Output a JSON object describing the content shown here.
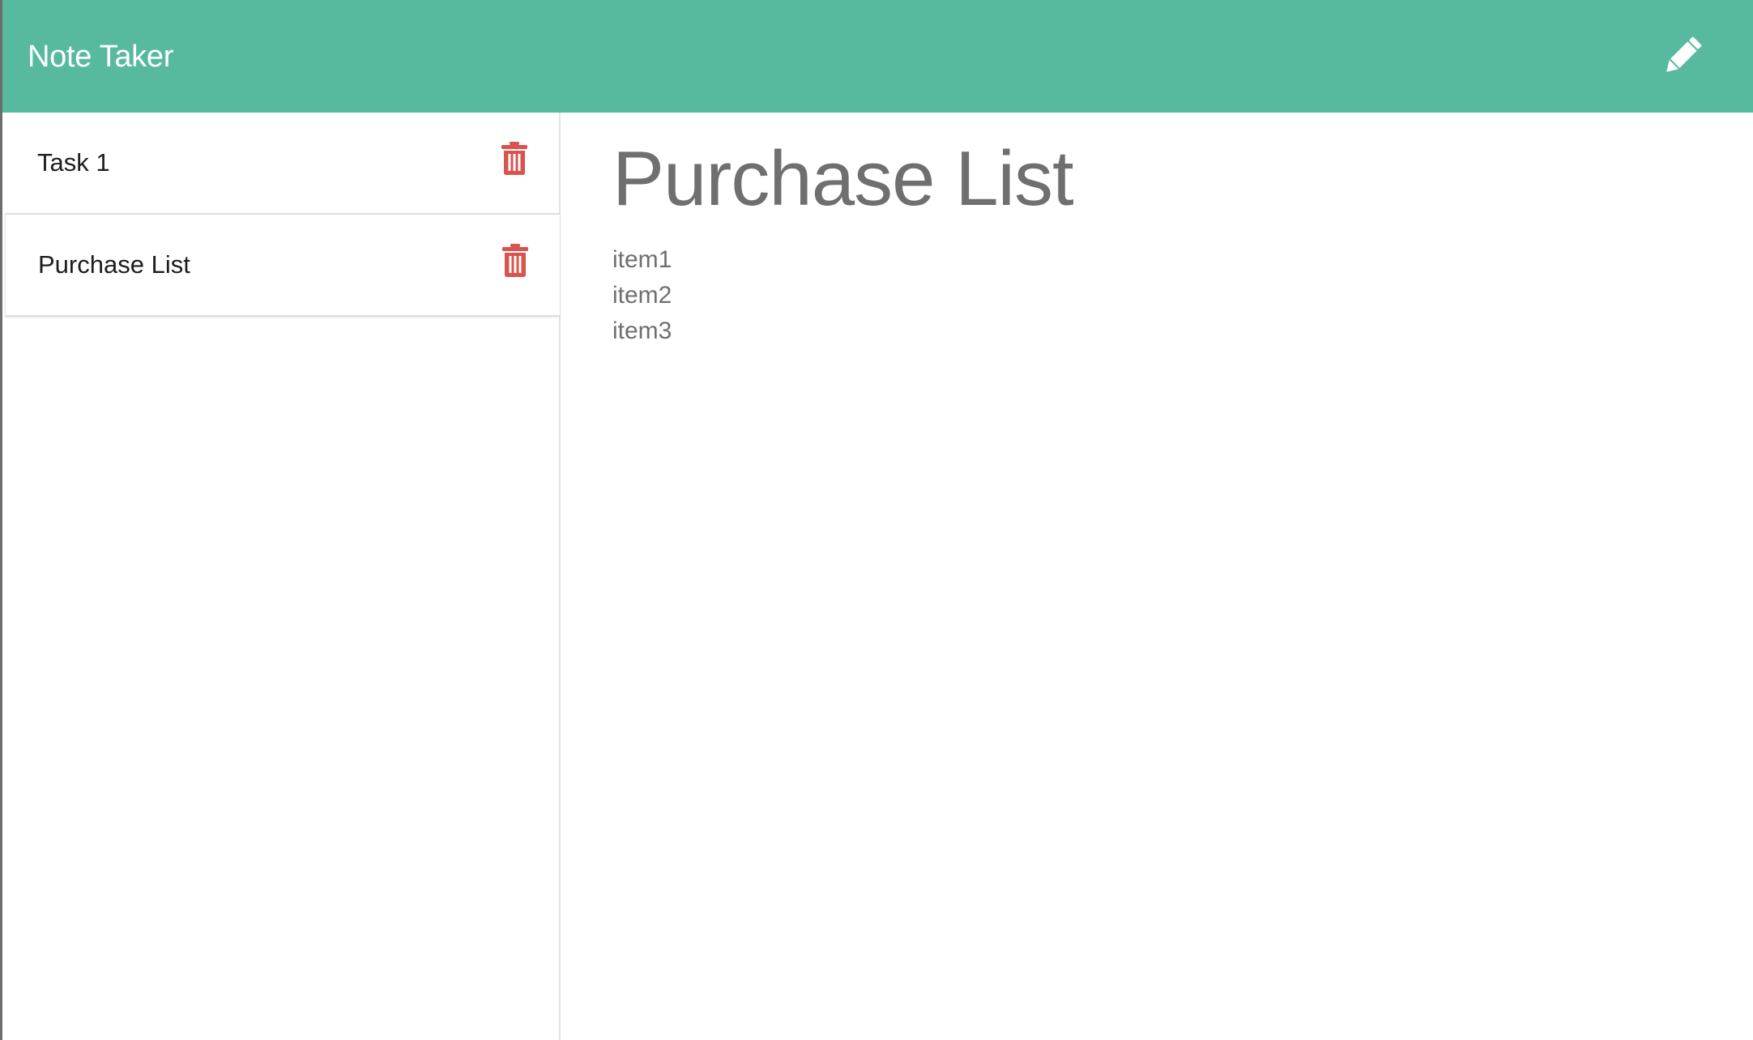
{
  "app": {
    "title": "Note Taker"
  },
  "toolbar": {
    "new_note_icon": "pencil-icon"
  },
  "notes": [
    {
      "title": "Task 1",
      "delete_icon": "trash-icon"
    },
    {
      "title": "Purchase List",
      "delete_icon": "trash-icon"
    }
  ],
  "active_note": {
    "title": "Purchase List",
    "lines": [
      "item1",
      "item2",
      "item3"
    ]
  },
  "colors": {
    "navbar": "#57ba9e",
    "delete_icon": "#d9534f",
    "heading_text": "#6f6f6f"
  }
}
